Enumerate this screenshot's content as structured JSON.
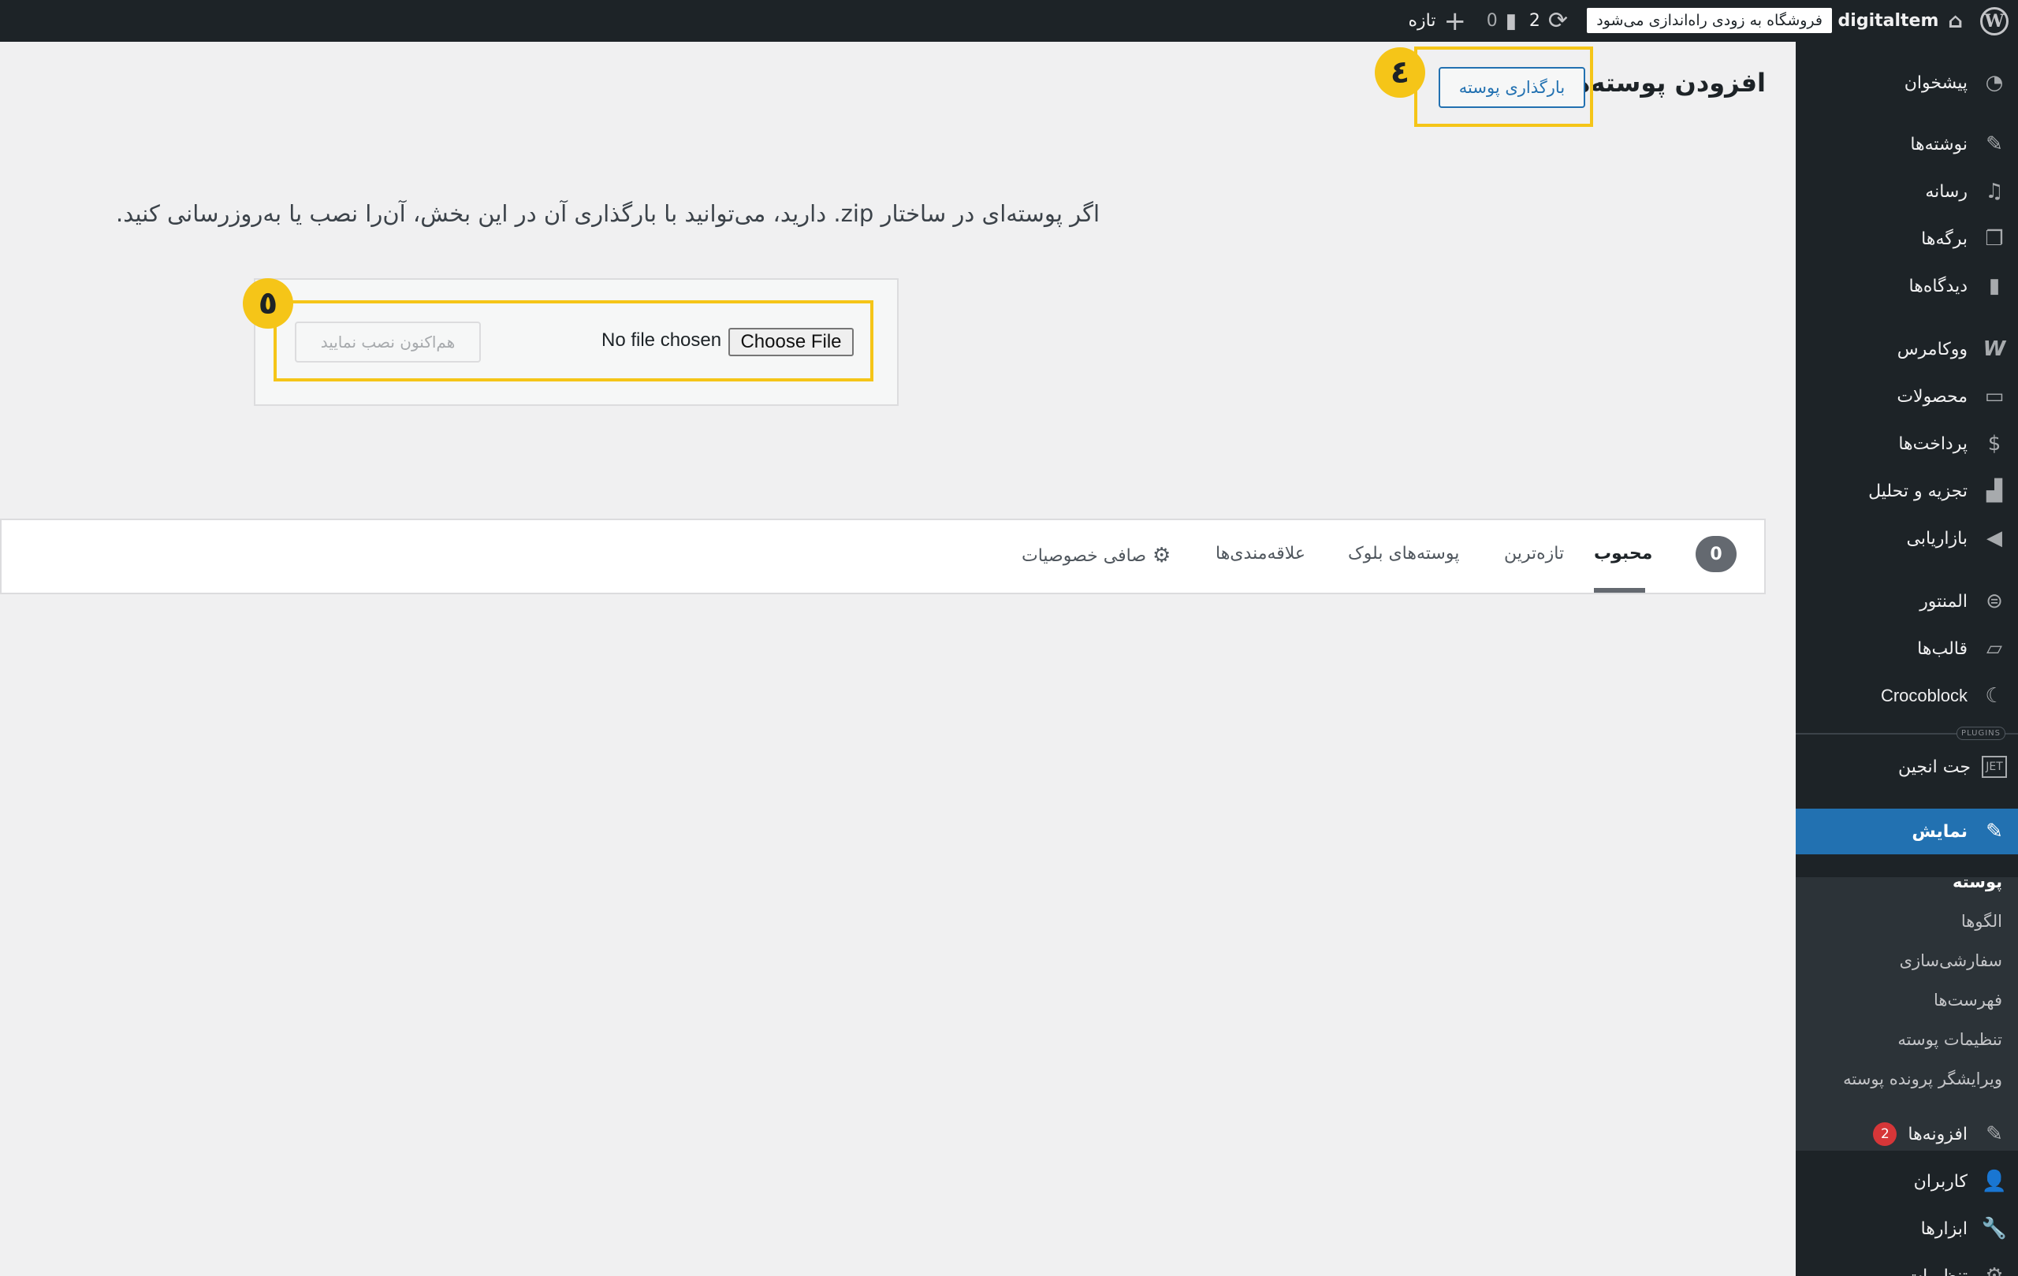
{
  "admin_bar": {
    "site_name": "digitaltem",
    "notice": "فروشگاه به زودی راه‌اندازی می‌شود",
    "updates_count": "2",
    "comments_count": "0",
    "new_label": "تازه"
  },
  "sidebar": {
    "items": [
      {
        "label": "پیشخوان",
        "icon": "dashboard-icon"
      },
      {
        "label": "نوشته‌ها",
        "icon": "pin-icon"
      },
      {
        "label": "رسانه",
        "icon": "media-icon"
      },
      {
        "label": "برگه‌ها",
        "icon": "pages-icon"
      },
      {
        "label": "دیدگاه‌ها",
        "icon": "comments-icon"
      },
      {
        "label": "ووکامرس",
        "icon": "woocommerce-icon"
      },
      {
        "label": "محصولات",
        "icon": "products-icon"
      },
      {
        "label": "پرداخت‌ها",
        "icon": "payments-icon"
      },
      {
        "label": "تجزیه و تحلیل",
        "icon": "analytics-icon"
      },
      {
        "label": "بازاریابی",
        "icon": "marketing-icon"
      },
      {
        "label": "المنتور",
        "icon": "elementor-icon"
      },
      {
        "label": "قالب‌ها",
        "icon": "templates-icon"
      },
      {
        "label": "Crocoblock",
        "icon": "crocoblock-icon"
      },
      {
        "label": "جت انجین",
        "icon": "jetengine-icon"
      },
      {
        "label": "نمایش",
        "icon": "appearance-icon"
      }
    ],
    "separator_tag": "PLUGINS",
    "submenu": [
      {
        "label": "پوسته"
      },
      {
        "label": "الگوها"
      },
      {
        "label": "سفارشی‌سازی"
      },
      {
        "label": "فهرست‌ها"
      },
      {
        "label": "تنظیمات پوسته"
      },
      {
        "label": "ویرایشگر پرونده پوسته"
      }
    ],
    "bottom_items": [
      {
        "label": "افزونه‌ها",
        "icon": "plugins-icon",
        "badge": "2"
      },
      {
        "label": "کاربران",
        "icon": "users-icon"
      },
      {
        "label": "ابزارها",
        "icon": "tools-icon"
      },
      {
        "label": "تنظیمات",
        "icon": "settings-icon"
      }
    ]
  },
  "main": {
    "title": "افزودن پوسته‌ها",
    "upload_button": "بارگذاری پوسته",
    "step_4": "٤",
    "step_5": "٥",
    "description": "اگر پوسته‌ای در ساختار zip. دارید، می‌توانید با بارگذاری آن در این بخش، آن‌را نصب یا به‌روزرسانی کنید.",
    "choose_file": "Choose File",
    "no_file": "No file chosen",
    "install_now": "هم‌اکنون نصب نمایید"
  },
  "filter_bar": {
    "count": "0",
    "tabs": [
      "محبوب",
      "تازه‌ترین",
      "پوسته‌های بلوک",
      "علاقه‌مندی‌ها"
    ],
    "feature_filter": "صافی خصوصیات"
  },
  "colors": {
    "admin_bar_bg": "#1d2327",
    "accent": "#2271b1",
    "highlight": "#f5c518",
    "badge": "#d63638"
  }
}
